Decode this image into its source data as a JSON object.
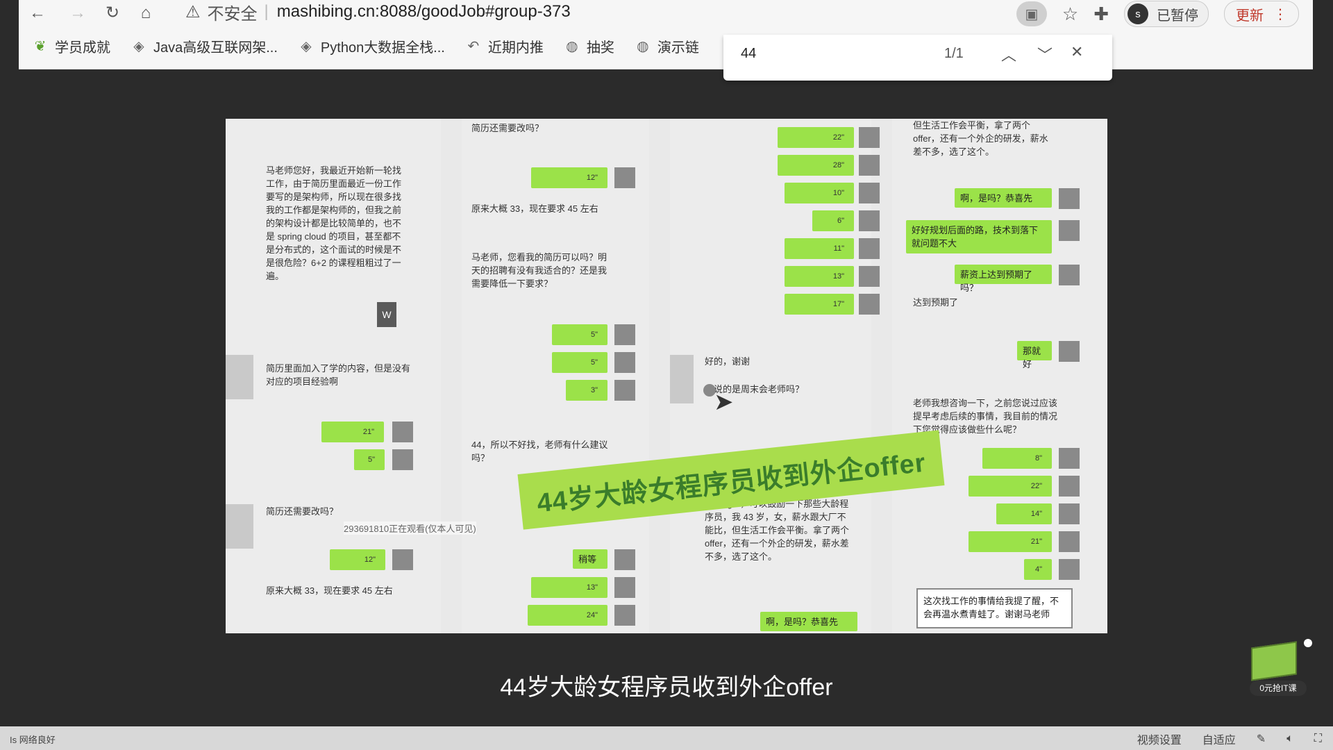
{
  "browser": {
    "security_label": "不安全",
    "url": "mashibing.cn:8088/goodJob#group-373",
    "paused_label": "已暂停",
    "avatar_letter": "s",
    "update_label": "更新"
  },
  "bookmarks": [
    {
      "label": "学员成就",
      "icon": "leaf-icon"
    },
    {
      "label": "Java高级互联网架...",
      "icon": "gem-icon"
    },
    {
      "label": "Python大数据全栈...",
      "icon": "gem-icon"
    },
    {
      "label": "近期内推",
      "icon": "share-icon"
    },
    {
      "label": "抽奖",
      "icon": "globe-icon"
    },
    {
      "label": "演示链",
      "icon": "globe-icon"
    }
  ],
  "find": {
    "query": "44",
    "count": "1/1"
  },
  "video": {
    "banner": "44岁大龄女程序员收到外企offer",
    "watermark": "293691810正在观看(仅本人可见)",
    "col1": {
      "intro": "马老师您好，我最近开始新一轮找工作，由于简历里面最近一份工作要写的是架构师，所以现在很多找我的工作都是架构师的，但我之前的架构设计都是比较简单的，也不是 spring cloud 的项目，甚至都不是分布式的，这个面试的时候是不是很危险？6+2 的课程粗粗过了一遍。",
      "msg2": "简历里面加入了学的内容，但是没有对应的项目经验啊",
      "msg3": "简历还需要改吗？",
      "msg4": "原来大概 33，现在要求 45 左右",
      "voice": [
        "21\"",
        "5\"",
        "12\""
      ]
    },
    "col2": {
      "msg1": "简历还需要改吗？",
      "msg2": "原来大概 33，现在要求 45 左右",
      "msg3": "马老师，您看我的简历可以吗？明天的招聘有没有我适合的？还是我需要降低一下要求？",
      "msg4": "44，所以不好找，老师有什么建议吗？",
      "reply": "稍等",
      "voice": [
        "12\"",
        "5\"",
        "5\"",
        "3\"",
        "13\"",
        "24\""
      ]
    },
    "col3": {
      "msg1": "好的，谢谢",
      "msg2": "您说的是周末会老师吗？",
      "msg3": "manager，可以鼓励一下那些大龄程序员，我 43 岁，女，薪水跟大厂不能比，但生活工作会平衡。拿了两个 offer，还有一个外企的研发，薪水差不多，选了这个。",
      "reply": "啊，是吗？恭喜先",
      "voice": [
        "22\"",
        "28\"",
        "10\"",
        "6\"",
        "11\"",
        "13\"",
        "17\""
      ]
    },
    "col4": {
      "msg1": "但生活工作会平衡，拿了两个 offer，还有一个外企的研发，薪水差不多，选了这个。",
      "reply1": "啊，是吗？恭喜先",
      "reply2": "好好规划后面的路，技术到落下就问题不大",
      "reply3": "薪资上达到预期了吗？",
      "msg2": "达到预期了",
      "reply4": "那就好",
      "msg3": "老师我想咨询一下，之前您说过应该提早考虑后续的事情，我目前的情况下您觉得应该做些什么呢？",
      "final": "这次找工作的事情给我提了醒，不会再温水煮青蛙了。谢谢马老师",
      "voice": [
        "8\"",
        "22\"",
        "14\"",
        "21\"",
        "4\""
      ]
    }
  },
  "subtitle": "44岁大龄女程序员收到外企offer",
  "player": {
    "left_text": "Is 网络良好",
    "video_settings": "视频设置",
    "fit": "自适应"
  },
  "promo": {
    "label": "0元抢IT课"
  }
}
